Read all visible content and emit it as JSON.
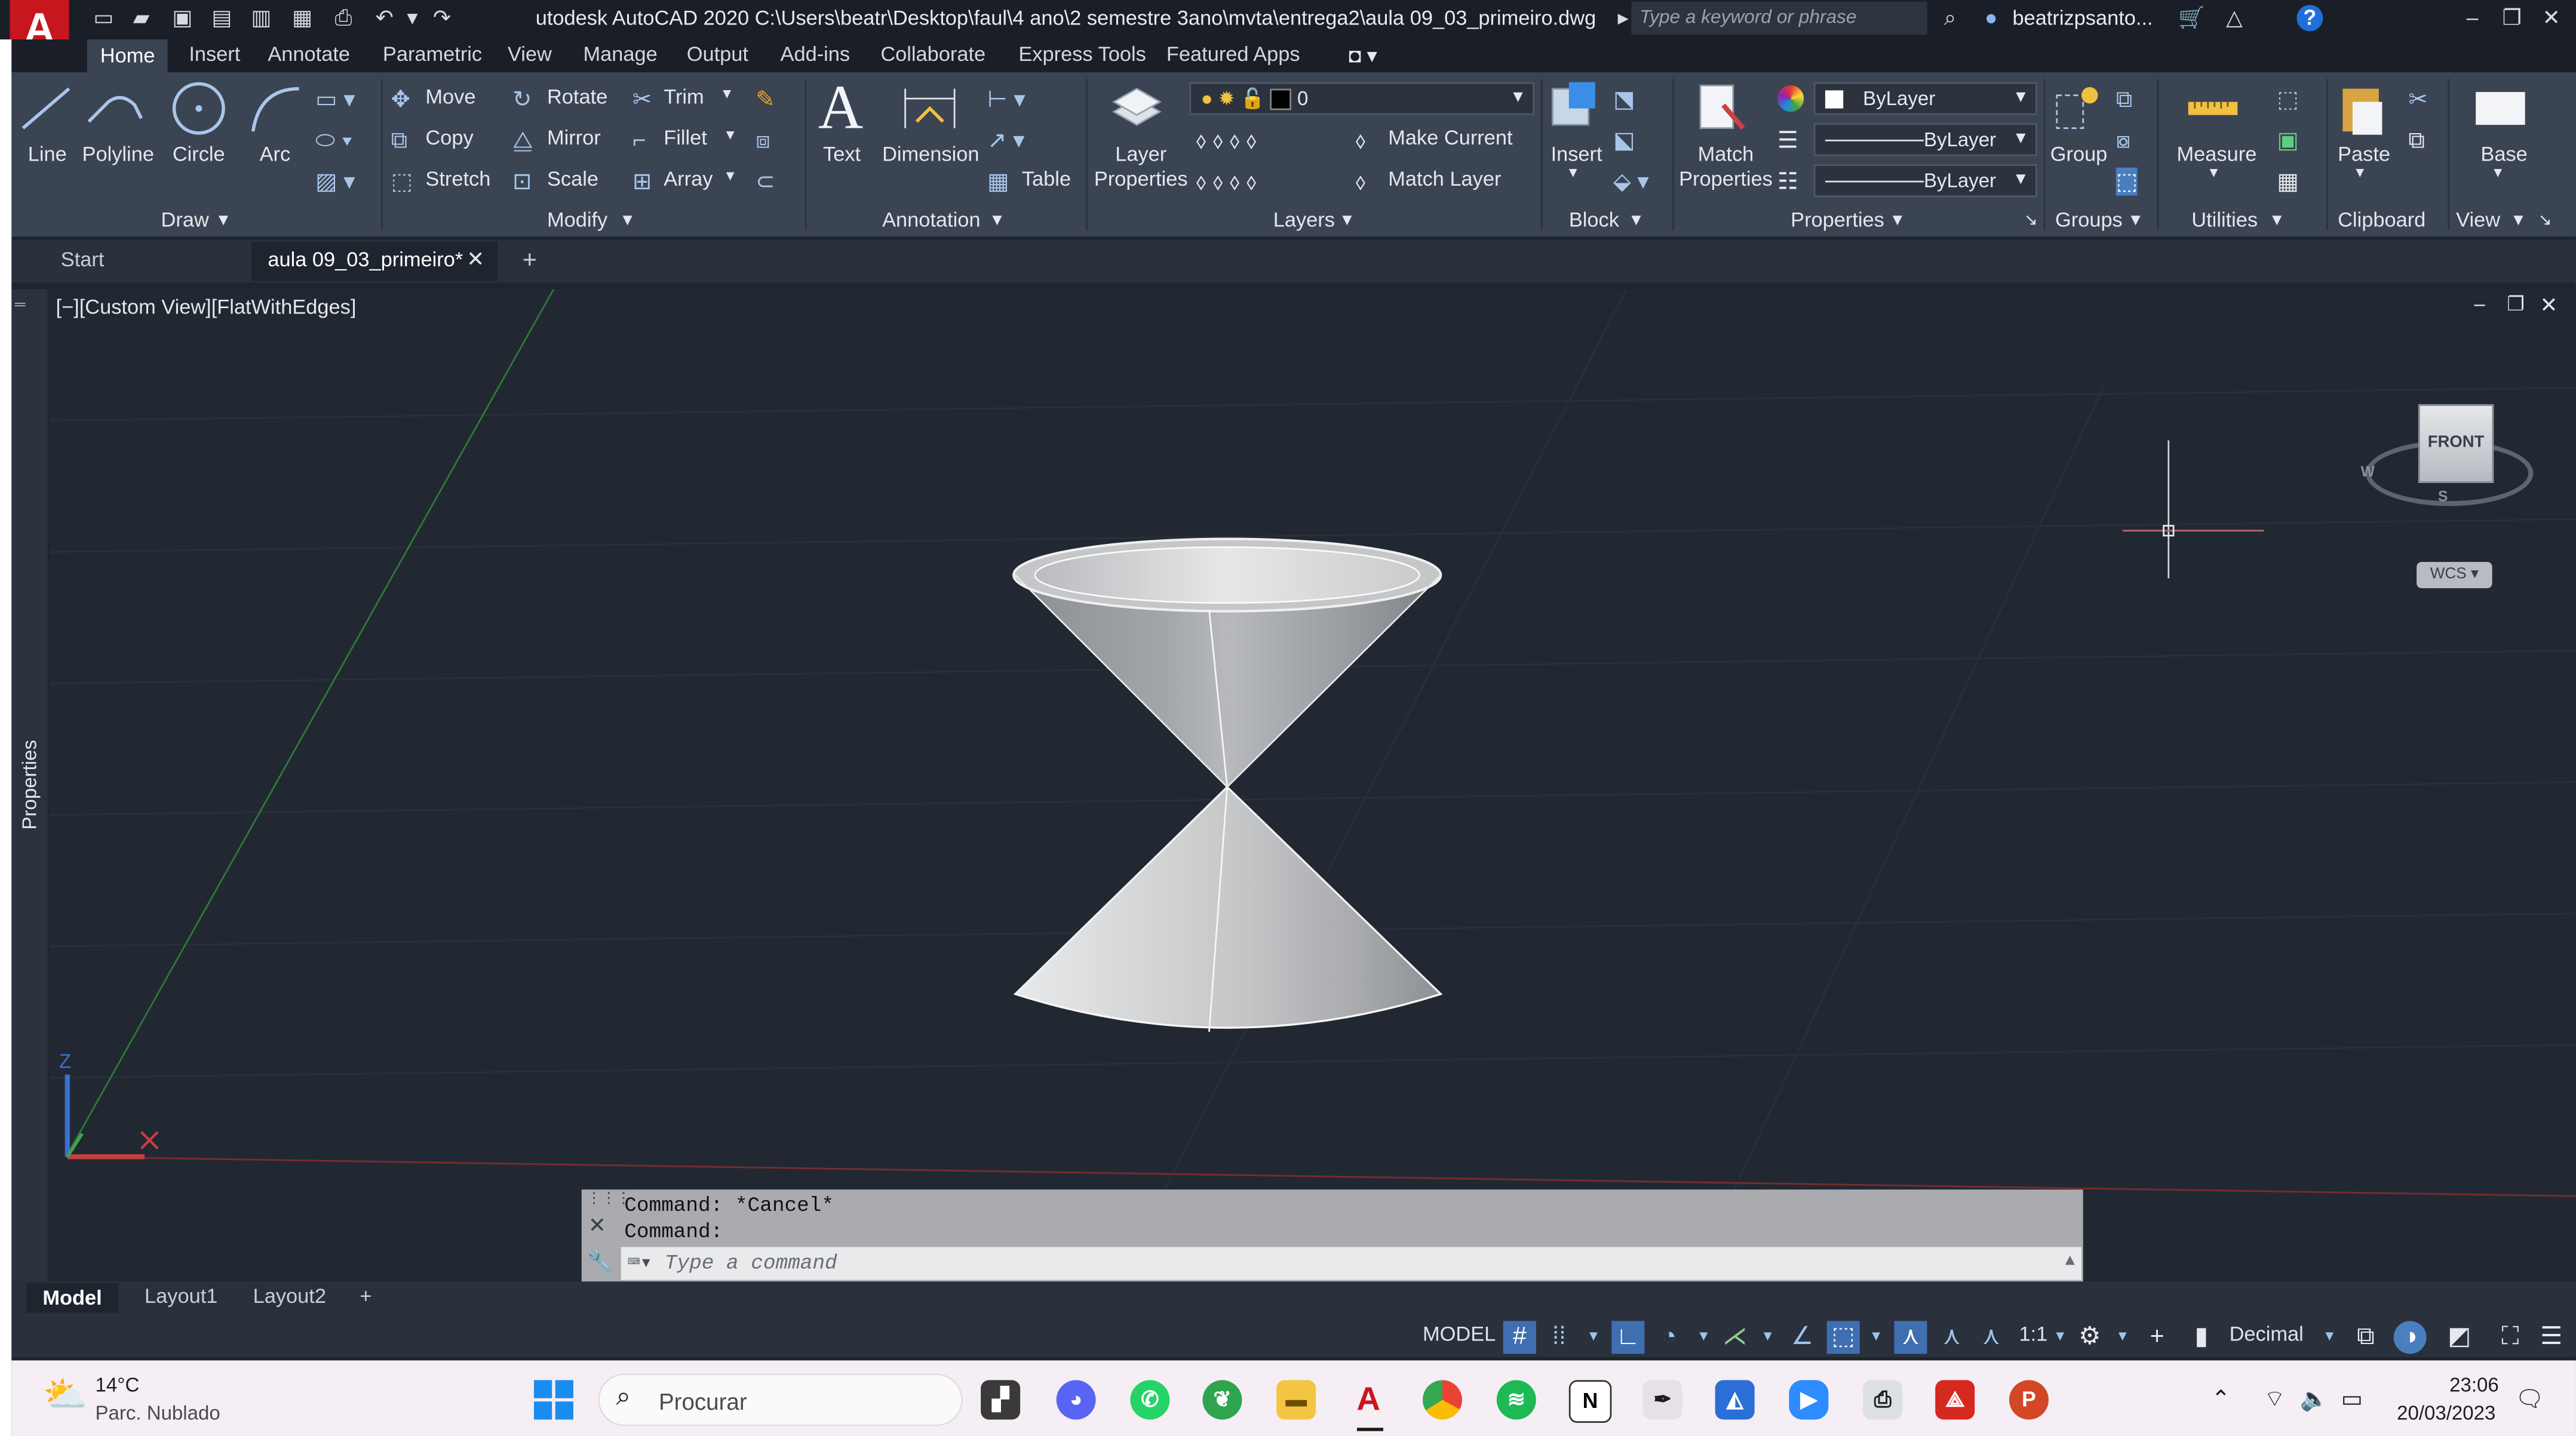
{
  "app": {
    "title": "utodesk AutoCAD 2020   C:\\Users\\beatr\\Desktop\\faul\\4 ano\\2 semestre 3ano\\mvta\\entrega2\\aula 09_03_primeiro.dwg",
    "search_placeholder": "Type a keyword or phrase",
    "user": "beatrizpsanto...",
    "logo_letter": "A"
  },
  "ribbon_tabs": [
    "Home",
    "Insert",
    "Annotate",
    "Parametric",
    "View",
    "Manage",
    "Output",
    "Add-ins",
    "Collaborate",
    "Express Tools",
    "Featured Apps"
  ],
  "ribbon": {
    "draw": {
      "line": "Line",
      "polyline": "Polyline",
      "circle": "Circle",
      "arc": "Arc",
      "panel": "Draw"
    },
    "modify": {
      "move": "Move",
      "rotate": "Rotate",
      "trim": "Trim",
      "copy": "Copy",
      "mirror": "Mirror",
      "fillet": "Fillet",
      "stretch": "Stretch",
      "scale": "Scale",
      "array": "Array",
      "panel": "Modify"
    },
    "annotation": {
      "text": "Text",
      "dimension": "Dimension",
      "table": "Table",
      "panel": "Annotation"
    },
    "layers": {
      "layer_properties": "Layer\nProperties",
      "layer_value": "0",
      "make_current": "Make Current",
      "match_layer": "Match Layer",
      "panel": "Layers"
    },
    "block": {
      "insert": "Insert",
      "panel": "Block"
    },
    "properties": {
      "match": "Match\nProperties",
      "color": "ByLayer",
      "linetype": "ByLayer",
      "lineweight": "ByLayer",
      "panel": "Properties"
    },
    "groups": {
      "group": "Group",
      "panel": "Groups"
    },
    "utilities": {
      "measure": "Measure",
      "panel": "Utilities"
    },
    "clipboard": {
      "paste": "Paste",
      "panel": "Clipboard"
    },
    "view": {
      "base": "Base",
      "panel": "View"
    }
  },
  "doc_tabs": {
    "start": "Start",
    "file": "aula 09_03_primeiro*"
  },
  "side_palette": "Properties",
  "viewport": {
    "label": "[−][Custom View][FlatWithEdges]",
    "viewcube_face": "FRONT",
    "wcs": "WCS",
    "compass_s": "S",
    "compass_w": "W",
    "axis_z": "Z"
  },
  "command": {
    "line1": "Command: *Cancel*",
    "line2": "Command:",
    "placeholder": "Type a command"
  },
  "layout_tabs": [
    "Model",
    "Layout1",
    "Layout2"
  ],
  "status": {
    "model": "MODEL",
    "scale": "1:1",
    "units": "Decimal"
  },
  "taskbar": {
    "weather_temp": "14°C",
    "weather_desc": "Parc. Nublado",
    "search": "Procurar",
    "time": "23:06",
    "date": "20/03/2023"
  },
  "colors": {
    "accent": "#c8161e",
    "ribbon": "#3b4453",
    "viewport": "#212832",
    "title": "#1a1f27"
  }
}
